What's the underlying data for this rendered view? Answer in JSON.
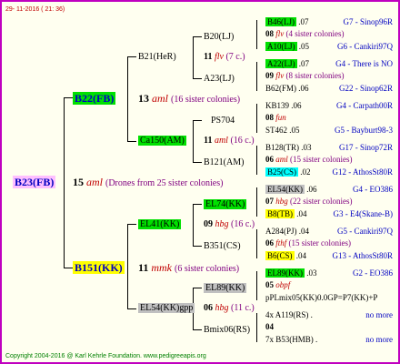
{
  "date": "29- 11-2016 ( 21: 36)",
  "footer": "Copyright 2004-2016 @ Karl Kehrle Foundation.     www.pedigreeapis.org",
  "root": {
    "id": "B23(FB)",
    "gen": "15",
    "code": "aml",
    "note": "(Drones from 25 sister colonies)"
  },
  "g1": [
    {
      "id": "B22(FB)",
      "gen": "13",
      "code": "aml",
      "note": "(16 sister colonies)"
    },
    {
      "id": "B151(KK)",
      "gen": "11",
      "code": "mmk",
      "note": "(6 sister colonies)"
    }
  ],
  "g2": [
    {
      "id": "B21(HeR)",
      "gen": "11",
      "code": "flv",
      "note": "(7 c.)"
    },
    {
      "id": "Ca150(AM)",
      "gen": "11",
      "code": "aml",
      "note": "(16 c.)"
    },
    {
      "id": "EL41(KK)",
      "gen": "09",
      "code": "hbg",
      "note": "(16 c.)"
    },
    {
      "id": "EL54(KK)gpp",
      "gen": "06",
      "code": "hbg",
      "note": "(11 c.)"
    }
  ],
  "g3": [
    {
      "id": "B20(LJ)"
    },
    {
      "id": "A23(LJ)"
    },
    {
      "id": "PS704"
    },
    {
      "id": "B121(AM)"
    },
    {
      "id": "EL74(KK)"
    },
    {
      "id": "B351(CS)"
    },
    {
      "id": "EL89(KK)"
    },
    {
      "id": "Bmix06(RS)"
    }
  ],
  "g4": [
    {
      "id": "B46(LJ)",
      "n": ".07",
      "link": "G7 - Sinop96R"
    },
    {
      "id": "08",
      "code": "flv",
      "note": "(4 sister colonies)"
    },
    {
      "id": "A10(LJ)",
      "n": ".05",
      "link": "G6 - Cankiri97Q"
    },
    {
      "id": "A22(LJ)",
      "n": ".07",
      "link": "G4 - There is NO"
    },
    {
      "id": "09",
      "code": "flv",
      "note": "(8 sister colonies)"
    },
    {
      "id": "B62(FM)",
      "n": ".06",
      "link": "G22 - Sinop62R"
    },
    {
      "id": "KB139",
      "n": ".06",
      "link": "G4 - Carpath00R"
    },
    {
      "id": "08",
      "code": "fun",
      "note": ""
    },
    {
      "id": "ST462",
      "n": ".05",
      "link": "G5 - Bayburt98-3"
    },
    {
      "id": "B128(TR)",
      "n": ".03",
      "link": "G17 - Sinop72R"
    },
    {
      "id": "06",
      "code": "aml",
      "note": "(15 sister colonies)"
    },
    {
      "id": "B25(CS)",
      "n": ".02",
      "link": "G12 - AthosSt80R"
    },
    {
      "id": "EL54(KK)",
      "n": ".06",
      "link": "G4 - EO386"
    },
    {
      "id": "07",
      "code": "hbg",
      "note": "(22 sister colonies)"
    },
    {
      "id": "B8(TB)",
      "n": ".04",
      "link": "G3 - E4(Skane-B)"
    },
    {
      "id": "A284(PJ)",
      "n": ".04",
      "link": "G5 - Cankiri97Q"
    },
    {
      "id": "06",
      "code": "fthf",
      "note": "(15 sister colonies)"
    },
    {
      "id": "B6(CS)",
      "n": ".04",
      "link": "G13 - AthosSt80R"
    },
    {
      "id": "EL89(KK)",
      "n": ".03",
      "link": "G2 - EO386"
    },
    {
      "id": "05",
      "code": "obpf",
      "note": ""
    },
    {
      "id": "pPLmix05(KK)",
      "n": "",
      "link": "0.0GP=P7(KK)+P"
    },
    {
      "id": "4x A119(RS)",
      "n": ".",
      "link": "no more"
    },
    {
      "id": "04",
      "code": "",
      "note": ""
    },
    {
      "id": "7x B53(HMB)",
      "n": ".",
      "link": "no more"
    }
  ]
}
